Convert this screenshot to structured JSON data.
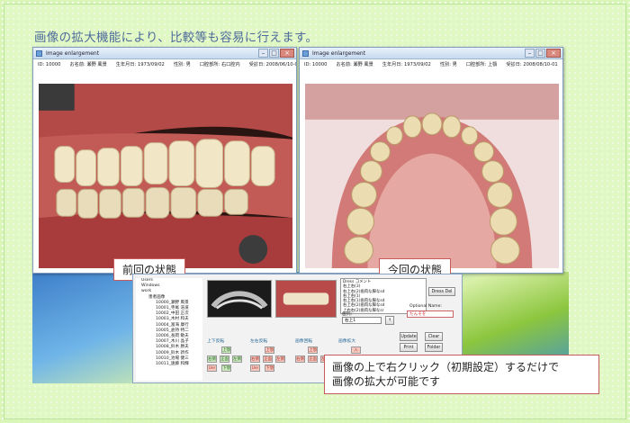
{
  "heading": "画像の拡大機能により、比較等も容易に行えます。",
  "left_window": {
    "title": "Image enlargement",
    "info": [
      "ID: 10000",
      "お名前: 瀬野 風景",
      "生年月日: 1973/09/02",
      "性別: 男",
      "口腔部所: 右口腔内",
      "受診日: 2008/06/10-01"
    ],
    "caption": "前回の状態"
  },
  "right_window": {
    "title": "Image enlargement",
    "info": [
      "ID: 10000",
      "お名前: 瀬野 風景",
      "生年月日: 1973/09/02",
      "性別: 男",
      "口腔部所: 上顎",
      "受診日: 2008/08/10-01"
    ],
    "caption": "今回の状態"
  },
  "main_window": {
    "tree": {
      "roots": [
        "Users",
        "Windows",
        "work"
      ],
      "folder": "患者画像",
      "patients": [
        "10000_瀬野 風景",
        "10001_寺尾 浩道",
        "10002_中田 正次",
        "10003_木村 和夫",
        "10004_富海 康行",
        "10005_倉持 特二",
        "10006_長岡 敏夫",
        "10007_木川 晶子",
        "10008_鈴木 勝夫",
        "10009_鈴木 新作",
        "10010_池場 健三",
        "10011_遠藤 和輝"
      ]
    },
    "notes": [
      "Dress コメント",
      "右上右(3)",
      "右上右(2)歯肉な脚なsd",
      "右上右(1)",
      "右上右(1)歯肉な脚なsd",
      "右上右(2)歯肉な脚なsd",
      "上右右(2)歯肉な脚なsr"
    ],
    "buttons": {
      "dress_del": "Dress Del",
      "update": "Update",
      "clear": "Clear",
      "print": "Print",
      "folder": "Folder"
    },
    "optional_label": "Optional Name:",
    "optional_value": "だんそを",
    "select_label": "歯列:",
    "select_value": "右上1",
    "group_labels": [
      "上下反転",
      "左右反転",
      "画像回転",
      "画像拡大"
    ],
    "mini_buttons": {
      "up": "上顎",
      "down": "下顎",
      "right": "右側",
      "front": "正面",
      "left": "左側",
      "upper": "Uer",
      "cnv": "入"
    }
  },
  "note": [
    "画像の上で右クリック（初期設定）するだけで",
    "画像の拡大が可能です"
  ]
}
